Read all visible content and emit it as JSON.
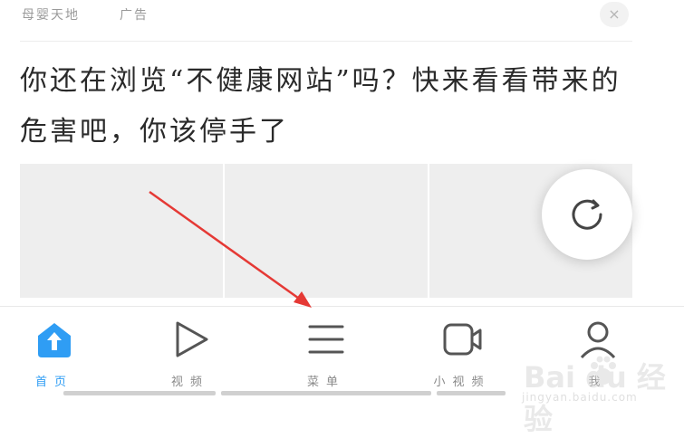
{
  "ad": {
    "source": "母婴天地",
    "tag": "广告",
    "close_label": "×",
    "headline": "你还在浏览“不健康网站”吗？快来看看带来的危害吧，你该停手了"
  },
  "tabs": [
    {
      "label": "首页",
      "icon": "home-icon",
      "active": true
    },
    {
      "label": "视频",
      "icon": "play-icon",
      "active": false
    },
    {
      "label": "菜单",
      "icon": "menu-icon",
      "active": false
    },
    {
      "label": "小视频",
      "icon": "video-camera-icon",
      "active": false
    },
    {
      "label": "我",
      "icon": "profile-icon",
      "active": false
    }
  ],
  "watermark": {
    "brand": "Bai du 经验",
    "url": "jingyan.baidu.com"
  },
  "colors": {
    "accent": "#2f9df4",
    "annotation_arrow": "#e53935"
  }
}
